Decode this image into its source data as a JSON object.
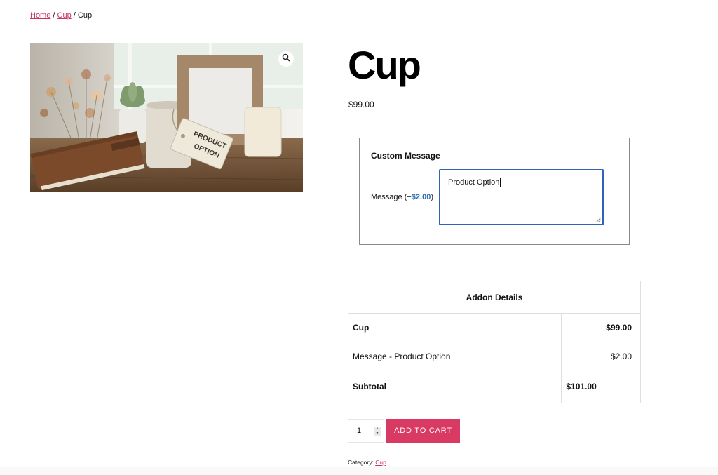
{
  "breadcrumb": {
    "home": "Home",
    "category": "Cup",
    "separator": "/",
    "current": "Cup"
  },
  "product": {
    "title": "Cup",
    "price": "$99.00",
    "image_text": "PRODUCT OPTION"
  },
  "addon": {
    "heading": "Custom Message",
    "message_label_prefix": "Message (+",
    "message_price": "$2.00",
    "message_label_suffix": ")",
    "message_value": "Product Option"
  },
  "details": {
    "heading": "Addon Details",
    "rows": [
      {
        "label": "Cup",
        "value": "$99.00"
      },
      {
        "label": "Message - Product Option",
        "value": "$2.00"
      },
      {
        "label": "Subtotal",
        "value": "$101.00"
      }
    ]
  },
  "cart": {
    "quantity": "1",
    "button_label": "ADD TO CART"
  },
  "meta": {
    "category_label": "Category:",
    "category_value": "Cup"
  },
  "colors": {
    "accent": "#d93a63",
    "link": "#c8365f",
    "focus": "#2f62b8",
    "price_blue": "#2a6fb5"
  },
  "icons": {
    "zoom": "magnifier-icon",
    "spinner": "spinner-arrows-icon",
    "resize": "resize-grip-icon"
  }
}
